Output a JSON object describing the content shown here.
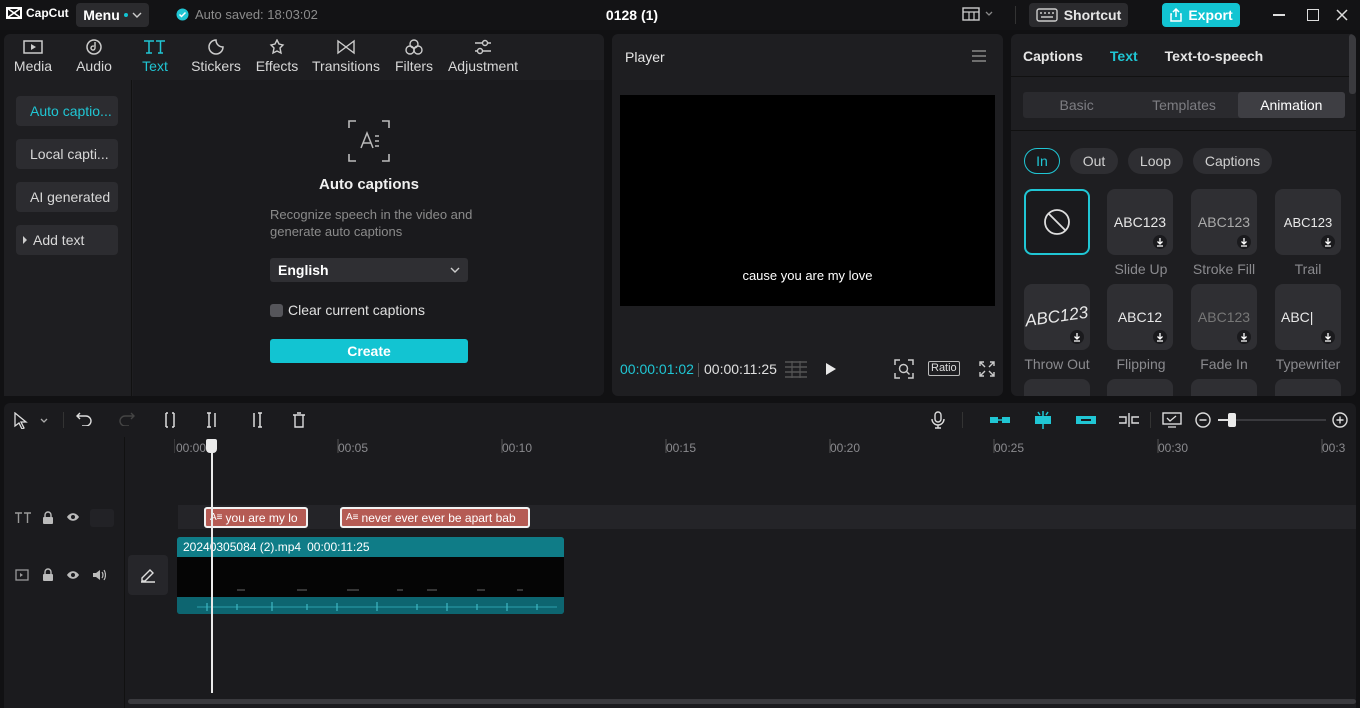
{
  "app": {
    "logo_text": "CapCut",
    "menu_label": "Menu",
    "autosave_text": "Auto saved: 18:03:02",
    "project_title": "0128 (1)",
    "shortcut_label": "Shortcut",
    "export_label": "Export",
    "accent_color": "#12c4d2"
  },
  "left_tabs": [
    {
      "label": "Media",
      "icon": "media-icon"
    },
    {
      "label": "Audio",
      "icon": "audio-icon"
    },
    {
      "label": "Text",
      "icon": "text-icon",
      "active": true
    },
    {
      "label": "Stickers",
      "icon": "stickers-icon"
    },
    {
      "label": "Effects",
      "icon": "effects-icon"
    },
    {
      "label": "Transitions",
      "icon": "transitions-icon"
    },
    {
      "label": "Filters",
      "icon": "filters-icon"
    },
    {
      "label": "Adjustment",
      "icon": "adjustment-icon"
    }
  ],
  "sidebar": {
    "items": [
      {
        "label": "Auto captio...",
        "active": true
      },
      {
        "label": "Local capti..."
      },
      {
        "label": "AI generated"
      },
      {
        "label": "Add text"
      }
    ]
  },
  "auto_captions": {
    "title": "Auto captions",
    "description": "Recognize speech in the video and generate auto captions",
    "language": "English",
    "clear_label": "Clear current captions",
    "create_label": "Create"
  },
  "player": {
    "title": "Player",
    "subtitle": "cause you are my love",
    "current_time": "00:00:01:02",
    "total_time": "00:00:11:25",
    "ratio_label": "Ratio"
  },
  "right_panel": {
    "tabs": [
      "Captions",
      "Text",
      "Text-to-speech"
    ],
    "active_tab": "Text",
    "segments": [
      "Basic",
      "Templates",
      "Animation"
    ],
    "active_segment": "Animation",
    "pills": [
      "In",
      "Out",
      "Loop",
      "Captions"
    ],
    "active_pill": "In",
    "animations": [
      {
        "preview": "",
        "label": "",
        "selected": true
      },
      {
        "preview": "ABC123",
        "label": "Slide Up"
      },
      {
        "preview": "ABC123",
        "label": "Stroke Fill"
      },
      {
        "preview": "ABC123",
        "label": "Trail"
      },
      {
        "preview": "ABC123",
        "label": "Throw Out"
      },
      {
        "preview": "ABC12",
        "label": "Flipping"
      },
      {
        "preview": "ABC123",
        "label": "Fade In"
      },
      {
        "preview": "ABC|",
        "label": "Typewriter"
      }
    ]
  },
  "timeline": {
    "ruler_labels": [
      "00:00",
      "00:05",
      "00:10",
      "00:15",
      "00:20",
      "00:25",
      "00:30",
      "00:3"
    ],
    "text_clips": [
      "you are my lo",
      "never ever ever be apart bab"
    ],
    "video_clip": {
      "name": "20240305084 (2).mp4",
      "duration": "00:00:11:25"
    },
    "zoom_fraction": 0.25
  }
}
